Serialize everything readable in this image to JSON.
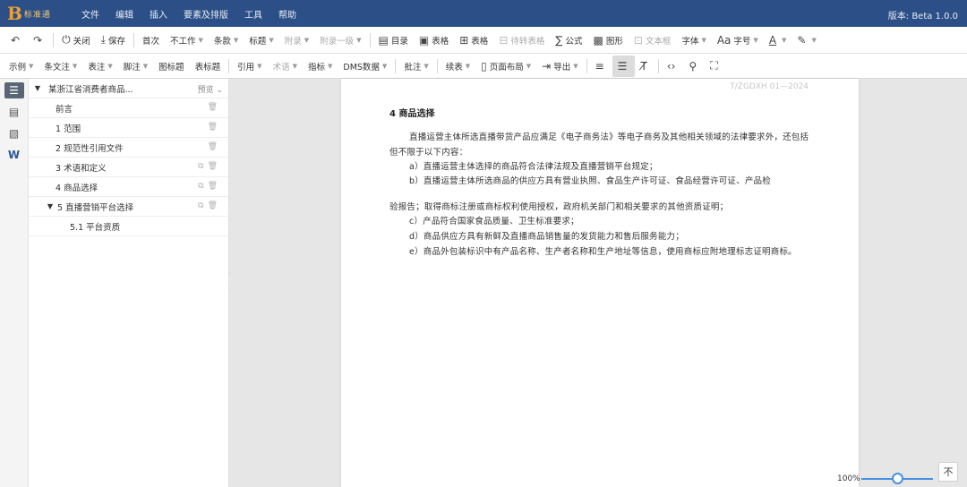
{
  "app": {
    "logo_letter": "B",
    "logo_text": "标准通",
    "menu": [
      "文件",
      "编辑",
      "插入",
      "要素及排版",
      "工具",
      "帮助"
    ],
    "version": "版本: Beta 1.0.0"
  },
  "toolbar1": {
    "undo": "↶",
    "redo": "↷",
    "close": "关闭",
    "save": "保存",
    "first_level": "首次",
    "items": [
      "不工作",
      "条款",
      "标题",
      "附录",
      "附录一级",
      "目录",
      "表格",
      "表格",
      "待转表格",
      "公式",
      "图形",
      "文本框",
      "字体",
      "字号"
    ],
    "font_color_label": "A",
    "highlight_label": "✎"
  },
  "toolbar2": {
    "items": [
      "示例",
      "条文注",
      "表注",
      "脚注",
      "图标题",
      "表标题",
      "引用",
      "术语",
      "指标",
      "DMS数据",
      "批注",
      "续表",
      "页面布局",
      "导出"
    ]
  },
  "outline": {
    "title": "某浙江省消费者商品...",
    "title_action": "预览",
    "items": [
      {
        "label": "前言",
        "level": 1
      },
      {
        "label": "1 范围",
        "level": 1
      },
      {
        "label": "2 规范性引用文件",
        "level": 1
      },
      {
        "label": "3 术语和定义",
        "level": 1
      },
      {
        "label": "4 商品选择",
        "level": 1
      },
      {
        "label": "5 直播营销平台选择",
        "level": 1,
        "expanded": true
      },
      {
        "label": "5.1 平台资质",
        "level": 2
      }
    ]
  },
  "document": {
    "header_code": "T/ZGDXH 01—2024",
    "section_title": "4 商品选择",
    "paragraphs": [
      "直播运营主体所选直播带货产品应满足《电子商务法》等电子商务及其他相关领域的法律要求外，还包括但不限于以下内容：",
      "a）直播运营主体选择的商品符合法律法规及直播营销平台规定；",
      "b）直播运营主体所选商品的供应方具有营业执照、食品生产许可证、食品经营许可证、产品检",
      "验报告；取得商标注册或商标权利使用授权，政府机关部门和相关要求的其他资质证明；",
      "c）产品符合国家食品质量、卫生标准要求；",
      "d）商品供应方具有新鲜及直播商品销售量的发货能力和售后服务能力；",
      "e）商品外包装标识中有产品名称、生产者名称和生产地址等信息，使用商标应附地理标志证明商标。"
    ]
  },
  "status": {
    "zoom": "100%",
    "zoom_level": 0.5
  }
}
